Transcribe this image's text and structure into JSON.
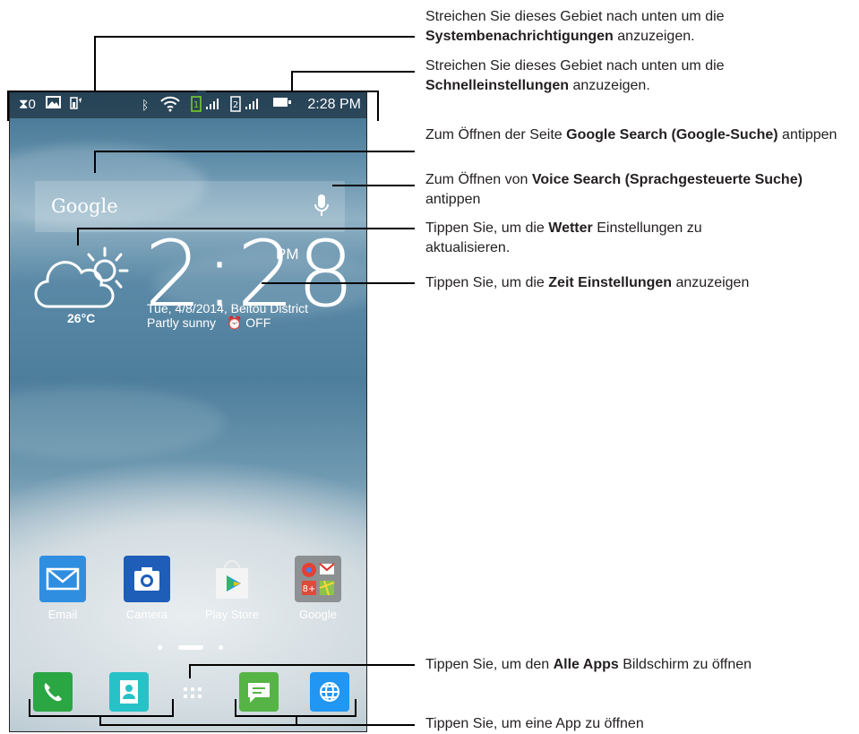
{
  "status_bar": {
    "time": "2:28 PM",
    "left_icons": [
      "download-icon",
      "gallery-icon",
      "battery-saver-icon"
    ],
    "right_icons": [
      "bluetooth-icon",
      "wifi-icon",
      "sim1-icon",
      "signal-icon",
      "sim2-icon",
      "signal-icon",
      "battery-icon"
    ]
  },
  "search": {
    "logo": "Google"
  },
  "weather": {
    "temperature": "26°C"
  },
  "clock": {
    "time": "2:28",
    "ampm": "PM",
    "date_location": "Tue, 4/8/2014, Beitou District",
    "condition": "Partly sunny",
    "alarm": "OFF"
  },
  "apps": [
    {
      "label": "Email"
    },
    {
      "label": "Camera"
    },
    {
      "label": "Play Store"
    },
    {
      "label": "Google"
    }
  ],
  "dock": [
    "phone-icon",
    "contacts-icon",
    "all-apps-icon",
    "messaging-icon",
    "browser-icon"
  ],
  "callouts": [
    {
      "pre": "Streichen Sie dieses Gebiet nach unten um die ",
      "bold": "Systembenachrichtigungen",
      "post": " anzuzeigen."
    },
    {
      "pre": "Streichen Sie dieses Gebiet nach unten um die ",
      "bold": "Schnelleinstellungen",
      "post": " anzuzeigen."
    },
    {
      "pre": "Zum Öffnen der Seite ",
      "bold": "Google Search (Google-Suche)",
      "post": " antippen"
    },
    {
      "pre": "Zum Öffnen von ",
      "bold": "Voice Search (Sprachgesteuerte Suche)",
      "post": " antippen"
    },
    {
      "pre": "Tippen Sie, um die ",
      "bold": "Wetter",
      "post": " Einstellungen zu aktualisieren."
    },
    {
      "pre": "Tippen Sie, um die ",
      "bold": "Zeit Einstellungen",
      "post": " anzuzeigen"
    },
    {
      "pre": "Tippen Sie, um den ",
      "bold": "Alle Apps",
      "post": " Bildschirm zu öffnen"
    },
    {
      "pre": "Tippen Sie, um eine App zu öffnen",
      "bold": "",
      "post": ""
    }
  ]
}
